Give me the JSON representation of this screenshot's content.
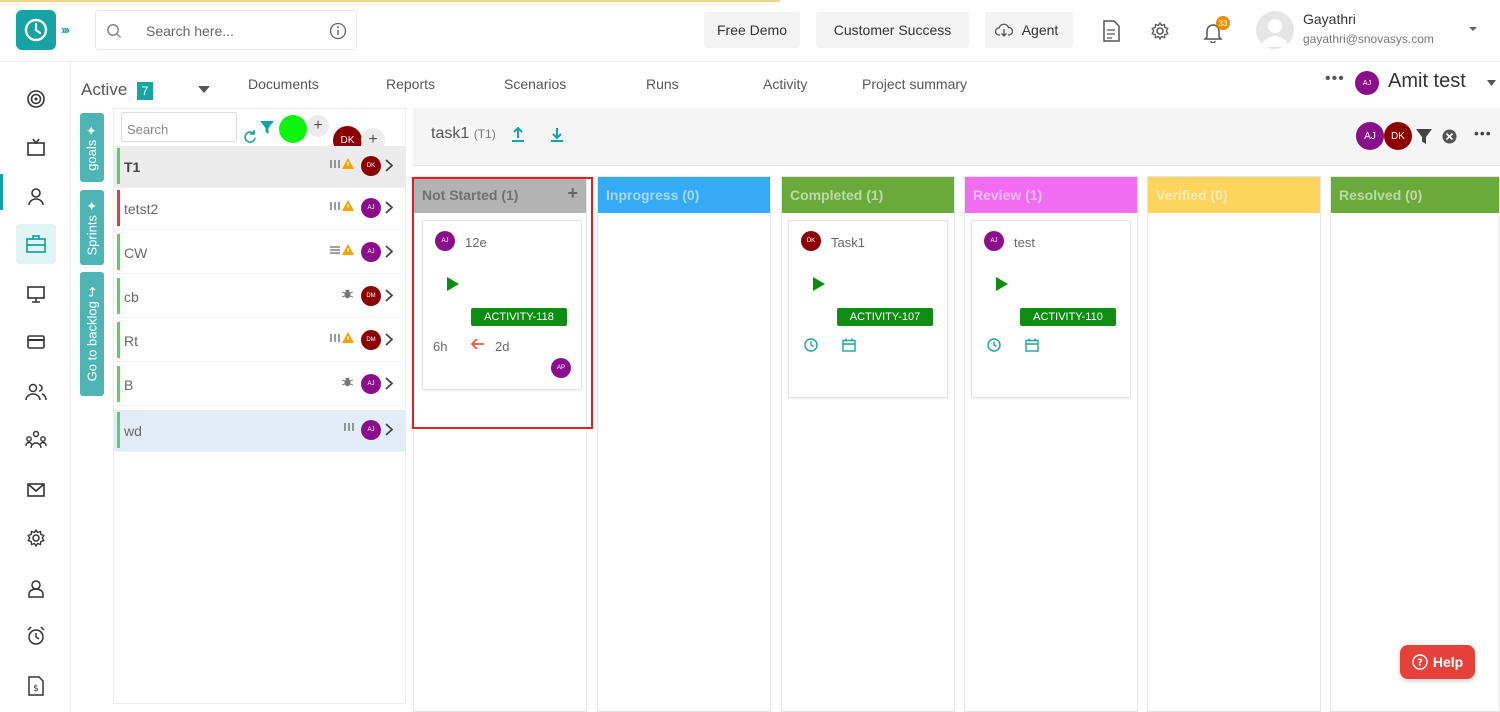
{
  "header": {
    "search_placeholder": "Search here...",
    "buttons": [
      "Free Demo",
      "Customer Success",
      "Agent"
    ],
    "notification_count": "33",
    "user_name": "Gayathri",
    "user_email": "gayathri@snovasys.com"
  },
  "nav": {
    "status_label": "Active",
    "status_count": "7",
    "tabs": [
      "Documents",
      "Reports",
      "Scenarios",
      "Runs",
      "Activity",
      "Project summary"
    ],
    "project_avatar": "AJ",
    "project_name": "Amit test"
  },
  "side_tabs": [
    "goals",
    "Sprints",
    "Go to backlog"
  ],
  "task_list": {
    "search_placeholder": "Search",
    "floating_avatar": "DK",
    "items": [
      {
        "name": "T1",
        "avatar": "DK",
        "avatar_color": "#8b0000"
      },
      {
        "name": "tetst2",
        "avatar": "AJ",
        "avatar_color": "#8b0f8b"
      },
      {
        "name": "CW",
        "avatar": "AJ",
        "avatar_color": "#8b0f8b"
      },
      {
        "name": "cb",
        "avatar": "DM",
        "avatar_color": "#8b0000"
      },
      {
        "name": "Rt",
        "avatar": "DM",
        "avatar_color": "#8b0000"
      },
      {
        "name": "B",
        "avatar": "AJ",
        "avatar_color": "#8b0f8b"
      },
      {
        "name": "wd",
        "avatar": "AJ",
        "avatar_color": "#8b0f8b"
      }
    ]
  },
  "board": {
    "name": "task1",
    "sub": "(T1)",
    "header_avatars": [
      "AJ",
      "DK"
    ],
    "columns": [
      {
        "title": "Not Started (1)",
        "color": "#b3b3b3"
      },
      {
        "title": "Inprogress (0)",
        "color": "#35aaf5"
      },
      {
        "title": "Completed (1)",
        "color": "#6aaa3a"
      },
      {
        "title": "Review (1)",
        "color": "#f26cf2"
      },
      {
        "title": "Verified (0)",
        "color": "#fcd45e"
      },
      {
        "title": "Resolved (0)",
        "color": "#6aaa3a"
      }
    ],
    "cards": [
      {
        "avatar": "AJ",
        "title": "12e",
        "badge": "ACTIVITY-118",
        "estimate": "6h",
        "remaining": "2d",
        "assignee": "AP"
      },
      {
        "avatar": "DK",
        "title": "Task1",
        "badge": "ACTIVITY-107"
      },
      {
        "avatar": "AJ",
        "title": "test",
        "badge": "ACTIVITY-110"
      }
    ]
  },
  "help_label": "Help"
}
